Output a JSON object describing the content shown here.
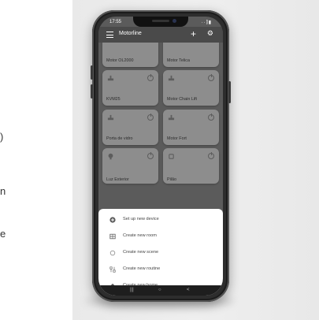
{
  "page_left_text": [
    ")",
    "n",
    "e"
  ],
  "status_bar": {
    "time": "17:55",
    "icons": "··⫿▮"
  },
  "app_bar": {
    "title": "Motorline",
    "add_glyph": "+",
    "settings_glyph": "⚙"
  },
  "devices": [
    {
      "label": "Motor OL2000"
    },
    {
      "label": "Motor Telica"
    },
    {
      "label": "KVM25"
    },
    {
      "label": "Motor Chain Lift"
    },
    {
      "label": "Porta de vidro"
    },
    {
      "label": "Motor Fort"
    },
    {
      "label": "Luz Exterior"
    },
    {
      "label": "Pilão"
    }
  ],
  "bottom_sheet": {
    "items": [
      {
        "label": "Set up new device",
        "icon": "plus-circle-icon"
      },
      {
        "label": "Create new room",
        "icon": "room-icon"
      },
      {
        "label": "Create new scene",
        "icon": "scene-icon"
      },
      {
        "label": "Create new routine",
        "icon": "routine-icon"
      },
      {
        "label": "Create new home",
        "icon": "home-icon"
      }
    ]
  },
  "nav_bar": {
    "recents": "|||",
    "home": "○",
    "back": "<"
  },
  "colors": {
    "card": "#8d8d8d",
    "screen_dim": "#5b5b5b",
    "app_bar": "#4a4a4a",
    "sheet": "#ffffff"
  }
}
